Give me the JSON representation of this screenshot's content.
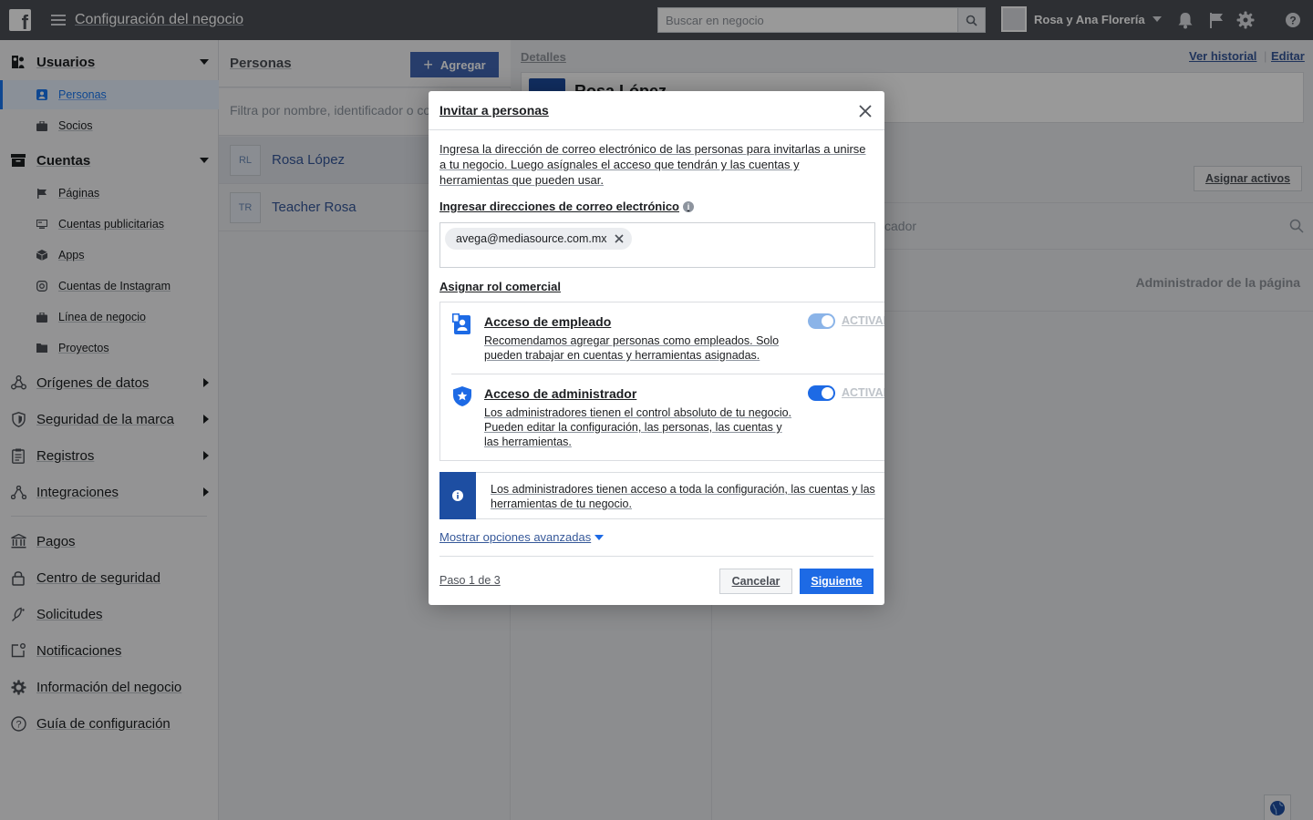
{
  "topbar": {
    "title": "Configuración del negocio",
    "search_placeholder": "Buscar en negocio",
    "business_name": "Rosa y Ana Florería"
  },
  "sidebar": {
    "users": {
      "label": "Usuarios",
      "items": [
        {
          "label": "Personas"
        },
        {
          "label": "Socios"
        }
      ]
    },
    "accounts": {
      "label": "Cuentas",
      "items": [
        {
          "label": "Páginas"
        },
        {
          "label": "Cuentas publicitarias"
        },
        {
          "label": "Apps"
        },
        {
          "label": "Cuentas de Instagram"
        },
        {
          "label": "Línea de negocio"
        },
        {
          "label": "Proyectos"
        }
      ]
    },
    "sections": [
      {
        "label": "Orígenes de datos"
      },
      {
        "label": "Seguridad de la marca"
      },
      {
        "label": "Registros"
      },
      {
        "label": "Integraciones"
      }
    ],
    "bottom": [
      {
        "label": "Pagos"
      },
      {
        "label": "Centro de seguridad"
      },
      {
        "label": "Solicitudes"
      },
      {
        "label": "Notificaciones"
      },
      {
        "label": "Información del negocio"
      },
      {
        "label": "Guía de configuración"
      }
    ]
  },
  "people_panel": {
    "title": "Personas",
    "add_label": "Agregar",
    "filter_placeholder": "Filtra por nombre, identificador o correo",
    "people": [
      {
        "initials": "RL",
        "name": "Rosa López"
      },
      {
        "initials": "TR",
        "name": "Teacher Rosa"
      }
    ]
  },
  "details": {
    "label": "Detalles",
    "history_link": "Ver historial",
    "edit_link": "Editar",
    "person_name": "Rosa López",
    "assign_assets": "Asignar activos",
    "search_fragment": "cador",
    "role_text": "Administrador de la página"
  },
  "modal": {
    "title": "Invitar a personas",
    "intro": "Ingresa la dirección de correo electrónico de las personas para invitarlas a unirse a tu negocio. Luego asígnales el acceso que tendrán y las cuentas y herramientas que pueden usar.",
    "email_label": "Ingresar direcciones de correo electrónico",
    "email_chip": "avega@mediasource.com.mx",
    "role_label": "Asignar rol comercial",
    "roles": [
      {
        "title": "Acceso de empleado",
        "desc": "Recomendamos agregar personas como empleados. Solo pueden trabajar en cuentas y herramientas asignadas.",
        "toggle_label": "ACTIVADO"
      },
      {
        "title": "Acceso de administrador",
        "desc": "Los administradores tienen el control absoluto de tu negocio. Pueden editar la configuración, las personas, las cuentas y las herramientas.",
        "toggle_label": "ACTIVADO"
      }
    ],
    "notice": "Los administradores tienen acceso a toda la configuración, las cuentas y las herramientas de tu negocio.",
    "advanced": "Mostrar opciones avanzadas",
    "step": "Paso 1 de 3",
    "cancel": "Cancelar",
    "next": "Siguiente"
  },
  "colors": {
    "topbar": "#4b4f56",
    "accent": "#1877f2",
    "primary_button": "#1d6ae5",
    "notice_bar": "#1d4ea2"
  }
}
